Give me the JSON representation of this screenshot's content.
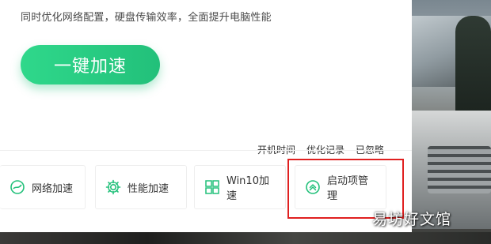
{
  "panel": {
    "subtitle": "同时优化网络配置，硬盘传输效率，全面提升电脑性能",
    "speed_button": "一键加速"
  },
  "links": [
    "开机时间",
    "优化记录",
    "已忽略"
  ],
  "tiles": [
    {
      "label": "网络加速",
      "icon": "network-icon"
    },
    {
      "label": "性能加速",
      "icon": "gear-icon"
    },
    {
      "label": "Win10加速",
      "icon": "windows-icon"
    },
    {
      "label": "启动项管理",
      "icon": "chevron-up-circle-icon"
    }
  ],
  "watermark": "易坊好文馆",
  "colors": {
    "accent": "#22c07a",
    "highlight": "#e02020"
  }
}
